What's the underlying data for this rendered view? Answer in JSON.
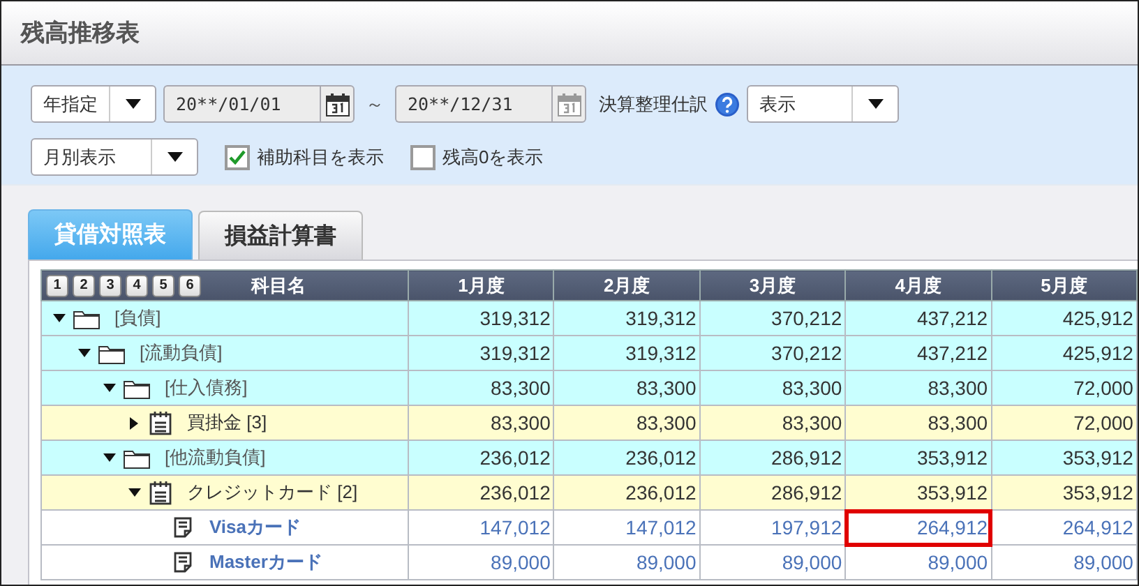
{
  "window": {
    "title": "残高推移表"
  },
  "filters": {
    "period_type": {
      "value": "年指定"
    },
    "date_from": {
      "value": "20**/01/01"
    },
    "separator": "～",
    "date_to": {
      "value": "20**/12/31"
    },
    "closing_entries_label": "決算整理仕訳",
    "closing_entries": {
      "value": "表示"
    },
    "display_mode": {
      "value": "月別表示"
    },
    "checkboxes": [
      {
        "label": "補助科目を表示",
        "checked": true
      },
      {
        "label": "残高0を表示",
        "checked": false
      }
    ]
  },
  "tabs": [
    {
      "label": "貸借対照表",
      "selected": true
    },
    {
      "label": "損益計算書",
      "selected": false
    }
  ],
  "table": {
    "level_buttons": [
      "1",
      "2",
      "3",
      "4",
      "5",
      "6"
    ],
    "name_header": "科目名",
    "month_columns": [
      "1月度",
      "2月度",
      "3月度",
      "4月度",
      "5月度"
    ],
    "rows": [
      {
        "kind": "group",
        "name": "[負債]",
        "expanded": true,
        "cells": [
          {
            "value": "319,312",
            "selected": false
          },
          {
            "value": "319,312",
            "selected": false
          },
          {
            "value": "370,212",
            "selected": false
          },
          {
            "value": "437,212",
            "selected": false
          },
          {
            "value": "425,912",
            "selected": false
          }
        ],
        "children": [
          {
            "kind": "group",
            "name": "[流動負債]",
            "expanded": true,
            "cells": [
              {
                "value": "319,312",
                "selected": false
              },
              {
                "value": "319,312",
                "selected": false
              },
              {
                "value": "370,212",
                "selected": false
              },
              {
                "value": "437,212",
                "selected": false
              },
              {
                "value": "425,912",
                "selected": false
              }
            ],
            "children": [
              {
                "kind": "group",
                "name": "[仕入債務]",
                "expanded": true,
                "cells": [
                  {
                    "value": "83,300",
                    "selected": false
                  },
                  {
                    "value": "83,300",
                    "selected": false
                  },
                  {
                    "value": "83,300",
                    "selected": false
                  },
                  {
                    "value": "83,300",
                    "selected": false
                  },
                  {
                    "value": "72,000",
                    "selected": false
                  }
                ],
                "children": [
                  {
                    "kind": "account",
                    "name": "買掛金 [3]",
                    "expanded": false,
                    "cells": [
                      {
                        "value": "83,300",
                        "selected": false
                      },
                      {
                        "value": "83,300",
                        "selected": false
                      },
                      {
                        "value": "83,300",
                        "selected": false
                      },
                      {
                        "value": "83,300",
                        "selected": false
                      },
                      {
                        "value": "72,000",
                        "selected": false
                      }
                    ]
                  }
                ]
              },
              {
                "kind": "group",
                "name": "[他流動負債]",
                "expanded": true,
                "cells": [
                  {
                    "value": "236,012",
                    "selected": false
                  },
                  {
                    "value": "236,012",
                    "selected": false
                  },
                  {
                    "value": "286,912",
                    "selected": false
                  },
                  {
                    "value": "353,912",
                    "selected": false
                  },
                  {
                    "value": "353,912",
                    "selected": false
                  }
                ],
                "children": [
                  {
                    "kind": "account",
                    "name": "クレジットカード [2]",
                    "expanded": true,
                    "cells": [
                      {
                        "value": "236,012",
                        "selected": false
                      },
                      {
                        "value": "236,012",
                        "selected": false
                      },
                      {
                        "value": "286,912",
                        "selected": false
                      },
                      {
                        "value": "353,912",
                        "selected": false
                      },
                      {
                        "value": "353,912",
                        "selected": false
                      }
                    ],
                    "children": [
                      {
                        "kind": "sub",
                        "name": "Visaカード",
                        "cells": [
                          {
                            "value": "147,012",
                            "selected": false
                          },
                          {
                            "value": "147,012",
                            "selected": false
                          },
                          {
                            "value": "197,912",
                            "selected": false
                          },
                          {
                            "value": "264,912",
                            "selected": true
                          },
                          {
                            "value": "264,912",
                            "selected": false
                          }
                        ]
                      },
                      {
                        "kind": "sub",
                        "name": "Masterカード",
                        "cells": [
                          {
                            "value": "89,000",
                            "selected": false
                          },
                          {
                            "value": "89,000",
                            "selected": false
                          },
                          {
                            "value": "89,000",
                            "selected": false
                          },
                          {
                            "value": "89,000",
                            "selected": false
                          },
                          {
                            "value": "89,000",
                            "selected": false
                          }
                        ]
                      }
                    ]
                  }
                ]
              }
            ]
          }
        ]
      }
    ]
  }
}
